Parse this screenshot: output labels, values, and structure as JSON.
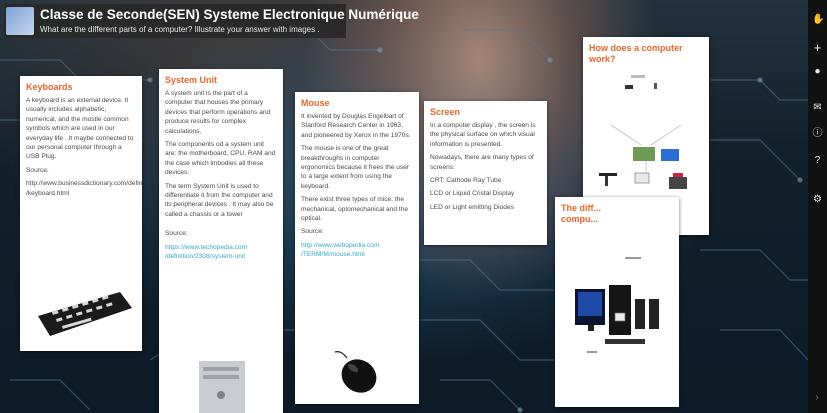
{
  "header": {
    "title": "Classe de Seconde(SEN) Systeme Electronique Numérique",
    "subtitle": "What are the different parts of a computer? Illustrate your answer with images ."
  },
  "toolbar": {
    "icons": [
      "hand-icon",
      "plus-icon",
      "user-icon",
      "email-icon",
      "info-icon",
      "help-icon",
      "settings-icon"
    ]
  },
  "cards": {
    "keyboards": {
      "title": "Keyboards",
      "body": "A keyboard is an external device. It usually includes alphabetic, numerical, and the mostle common symbols which are used in our everyday life . It maybe connected to our personal computer through a USB Plug.",
      "source_label": "Source:",
      "source_link": "http://www.businessdictionary.com/definition /keyboard.html"
    },
    "system": {
      "title": "System Unit",
      "p1": "A system unit is the part of a computer that houses the primary devices that perform operations and produce results for complex calculations.",
      "p2": "The components od a system unit are: the motherboard, CPU, RAM and the case which imbodies all these devices.",
      "p3": "The term System Unit is used to differentiate it from the computer and its peripheral devices . It may also be called a chassis or a tower",
      "source_label": "Source:",
      "source_link": "https://www.techopedia.com /definition/2308/system-unit"
    },
    "mouse": {
      "title": "Mouse",
      "p1": "It invented by Douglas Engelbart of Stanford Research Center in 1963, and pioneered by Xerox in the 1970s.",
      "p2": "The mouse is one of the great breakthroughs in computer ergonomics because it frees the user to a large extent from using the keyboard.",
      "p3": "There exist three types of mice: the mechanical, optomechanical and the optical.",
      "source_label": "Source:",
      "source_link": "http://www.webopedia.com /TERM/M/mouse.html"
    },
    "screen": {
      "title": "Screen",
      "p1": "In a computer display , the screen is the physical surface on which visual information is presented.",
      "p2": "Nowadays, there are many types of screens:",
      "items": [
        "CRT: Cathode Ray Tube",
        "LCD or Liquid Cristal Display",
        "LED or Light emitting Diodes"
      ]
    },
    "how": {
      "title": "How does a computer work?"
    },
    "diff": {
      "title": "The diff... compu..."
    }
  },
  "colors": {
    "card_title": "#e8662a",
    "link": "#33aacc",
    "header_bg": "#282828"
  }
}
